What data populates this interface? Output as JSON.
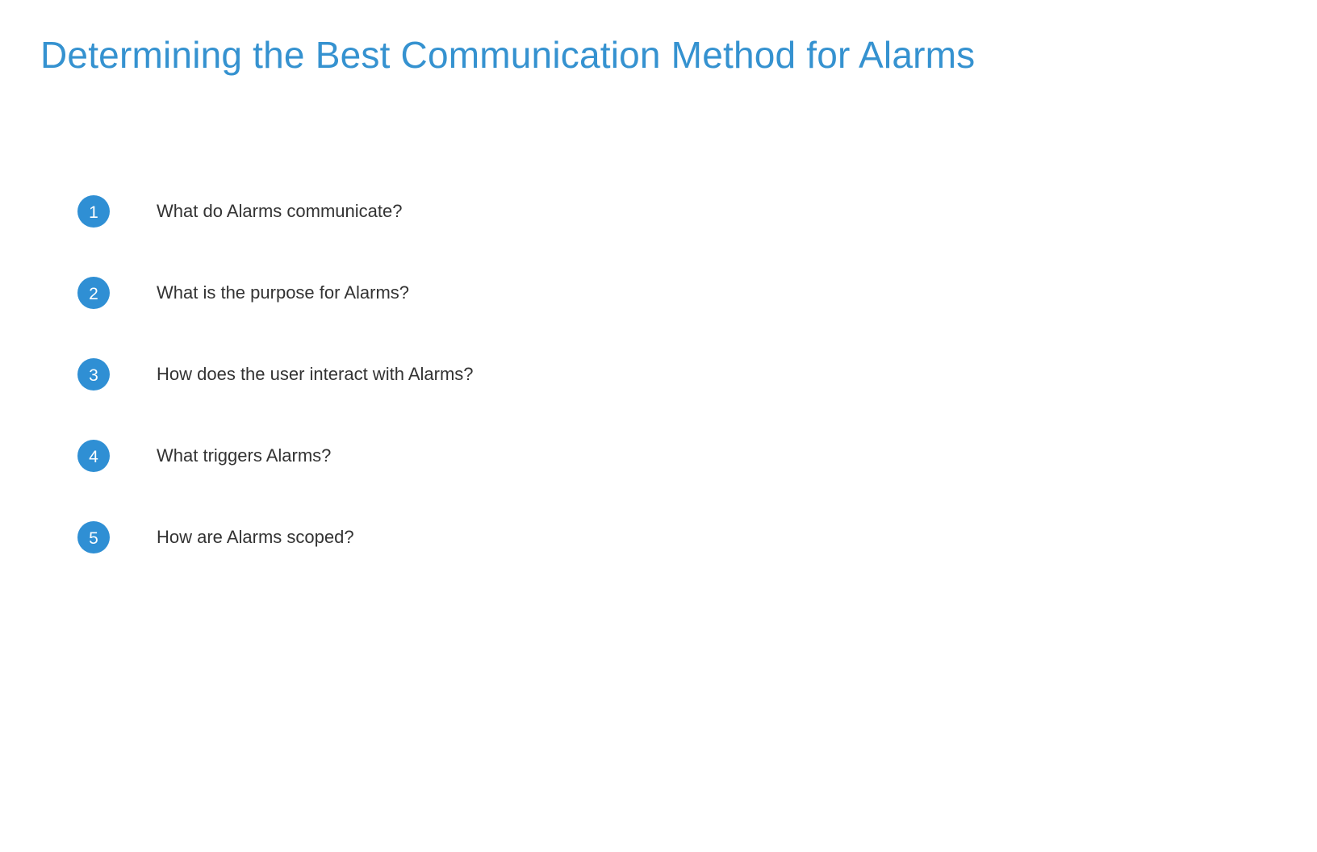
{
  "slide": {
    "title": "Determining the Best Communication Method for Alarms",
    "questions": [
      {
        "number": "1",
        "text": "What do Alarms communicate?"
      },
      {
        "number": "2",
        "text": "What is the purpose for Alarms?"
      },
      {
        "number": "3",
        "text": "How does the user interact with Alarms?"
      },
      {
        "number": "4",
        "text": "What triggers Alarms?"
      },
      {
        "number": "5",
        "text": "How are Alarms scoped?"
      }
    ]
  },
  "colors": {
    "title": "#3592d0",
    "badge": "#2f8fd4",
    "badge_text": "#ffffff",
    "body_text": "#333333",
    "background": "#ffffff"
  }
}
